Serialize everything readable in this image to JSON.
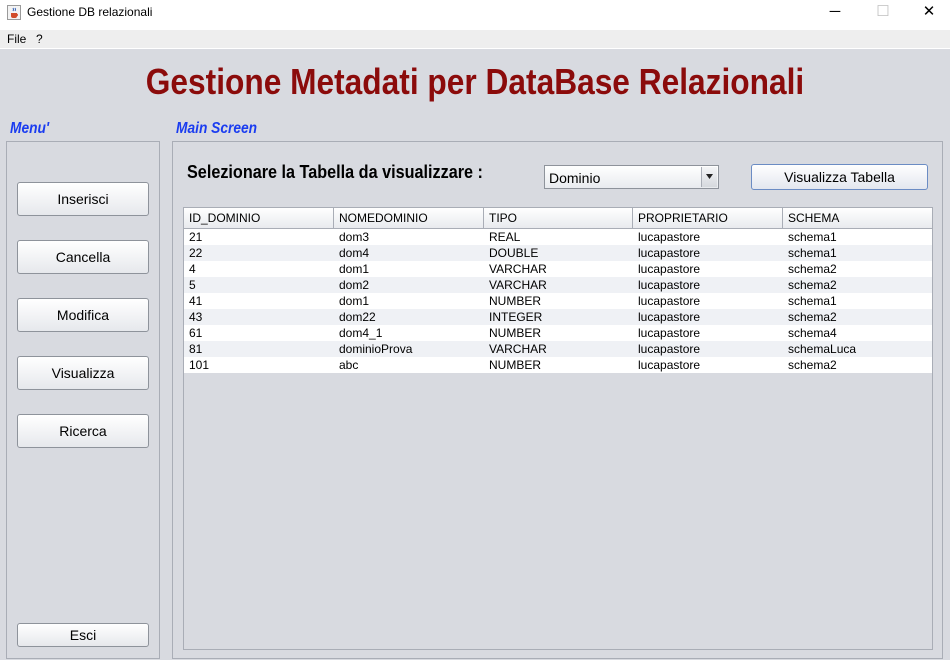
{
  "window": {
    "title": "Gestione DB relazionali",
    "minimize": "─",
    "maximize": "☐",
    "close": "✕"
  },
  "menubar": {
    "items": [
      "File",
      "?"
    ]
  },
  "header": {
    "title": "Gestione Metadati per DataBase Relazionali"
  },
  "sidebar": {
    "label": "Menu'",
    "buttons": [
      "Inserisci",
      "Cancella",
      "Modifica",
      "Visualizza",
      "Ricerca"
    ],
    "exit_label": "Esci"
  },
  "main": {
    "label": "Main Screen",
    "select_label": "Selezionare la Tabella da visualizzare :",
    "combo_value": "Dominio",
    "show_button": "Visualizza Tabella",
    "table": {
      "columns": [
        "ID_DOMINIO",
        "NOMEDOMINIO",
        "TIPO",
        "PROPRIETARIO",
        "SCHEMA"
      ],
      "rows": [
        [
          "21",
          "dom3",
          "REAL",
          "lucapastore",
          "schema1"
        ],
        [
          "22",
          "dom4",
          "DOUBLE",
          "lucapastore",
          "schema1"
        ],
        [
          "4",
          "dom1",
          "VARCHAR",
          "lucapastore",
          "schema2"
        ],
        [
          "5",
          "dom2",
          "VARCHAR",
          "lucapastore",
          "schema2"
        ],
        [
          "41",
          "dom1",
          "NUMBER",
          "lucapastore",
          "schema1"
        ],
        [
          "43",
          "dom22",
          "INTEGER",
          "lucapastore",
          "schema2"
        ],
        [
          "61",
          "dom4_1",
          "NUMBER",
          "lucapastore",
          "schema4"
        ],
        [
          "81",
          "dominioProva",
          "VARCHAR",
          "lucapastore",
          "schemaLuca"
        ],
        [
          "101",
          "abc",
          "NUMBER",
          "lucapastore",
          "schema2"
        ]
      ]
    }
  },
  "colors": {
    "title": "#8b0b0b",
    "section_label": "#1a3cf0",
    "background": "#d8dae0"
  },
  "icons": {
    "app": "java-cup-icon",
    "combo_arrow": "triangle-down-icon"
  }
}
